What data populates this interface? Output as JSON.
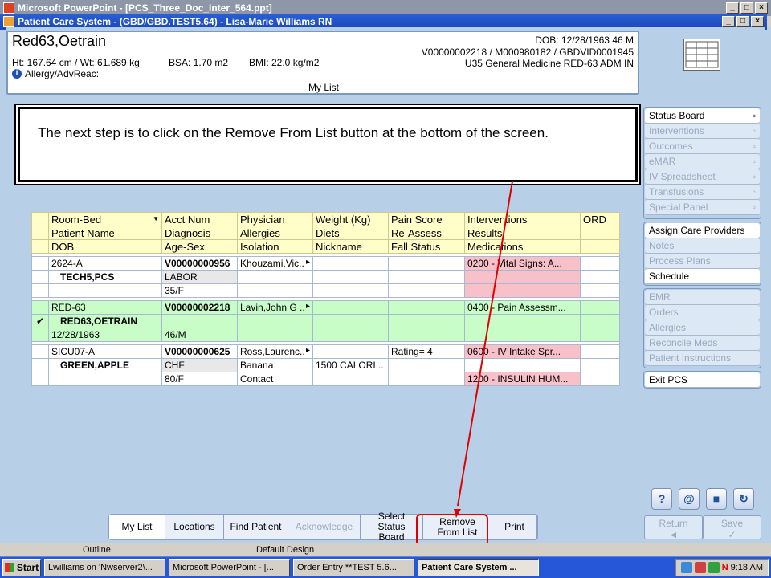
{
  "ppt_title": "Microsoft PowerPoint - [PCS_Three_Doc_Inter_564.ppt]",
  "app_title": "Patient Care System - (GBD/GBD.TEST5.64) - Lisa-Marie Williams RN",
  "patient": {
    "name": "Red63,Oetrain",
    "vitals": "Ht: 167.64 cm / Wt: 61.689 kg",
    "bsa": "BSA: 1.70 m2",
    "bmi": "BMI: 22.0 kg/m2",
    "allergy": "Allergy/AdvReac:",
    "dob": "DOB: 12/28/1963 46 M",
    "ids": "V00000002218 / M000980182 / GBDVID0001945",
    "location": "U35 General Medicine  RED-63  ADM IN"
  },
  "list_title": "My List",
  "popup_text": "The next step is to click on the Remove From List button at the bottom of the screen.",
  "grid": {
    "headers": [
      [
        "Room-Bed",
        "Acct Num",
        "Physician",
        "Weight (Kg)",
        "Pain Score",
        "Interventions",
        "ORD"
      ],
      [
        "Patient Name",
        "Diagnosis",
        "Allergies",
        "Diets",
        "Re-Assess",
        "Results",
        ""
      ],
      [
        "DOB",
        "Age-Sex",
        "Isolation",
        "Nickname",
        "Fall Status",
        "Medications",
        ""
      ]
    ],
    "patients": [
      {
        "rows": [
          [
            "2624-A",
            "V00000000956",
            "Khouzami,Vic..",
            "",
            "",
            "0200 - Vital Signs: A...",
            ""
          ],
          [
            "TECH5,PCS",
            "LABOR",
            "",
            "",
            "",
            "",
            ""
          ],
          [
            "",
            "35/F",
            "",
            "",
            "",
            "",
            ""
          ]
        ]
      },
      {
        "rows": [
          [
            "RED-63",
            "V00000002218",
            "Lavin,John G ..",
            "",
            "",
            "0400 - Pain Assessm...",
            ""
          ],
          [
            "RED63,OETRAIN",
            "",
            "",
            "",
            "",
            "",
            ""
          ],
          [
            "12/28/1963",
            "46/M",
            "",
            "",
            "",
            "",
            ""
          ]
        ]
      },
      {
        "rows": [
          [
            "SICU07-A",
            "V00000000625",
            "Ross,Laurenc..",
            "",
            "Rating= 4",
            "0600 - IV Intake Spr...",
            ""
          ],
          [
            "GREEN,APPLE",
            "CHF",
            "Banana",
            "1500 CALORI...",
            "",
            "",
            ""
          ],
          [
            "",
            "80/F",
            "Contact",
            "",
            "",
            "1200 - INSULIN HUM...",
            ""
          ]
        ]
      }
    ],
    "check_mark": "✔"
  },
  "side_group1": [
    "Status Board",
    "Interventions",
    "Outcomes",
    "eMAR",
    "IV Spreadsheet",
    "Transfusions",
    "Special Panel"
  ],
  "side_group2": [
    "Assign Care Providers",
    "Notes",
    "Process Plans",
    "Schedule"
  ],
  "side_group3": [
    "EMR",
    "Orders",
    "Allergies",
    "Reconcile Meds",
    "Patient Instructions"
  ],
  "side_exit": "Exit PCS",
  "nav": {
    "return": "Return",
    "save": "Save"
  },
  "bottom_buttons": [
    "My List",
    "Locations",
    "Find Patient",
    "Acknowledge",
    "Select Status Board",
    "Remove From List",
    "Print"
  ],
  "status": {
    "left": "Outline",
    "mid": "Default Design"
  },
  "taskbar": {
    "start": "Start",
    "tasks": [
      "Lwilliams on 'Nwserver2\\...",
      "Microsoft PowerPoint - [...",
      "Order Entry **TEST 5.6...",
      "Patient Care System ..."
    ],
    "clock": "9:18 AM"
  },
  "accent": "#e00000"
}
